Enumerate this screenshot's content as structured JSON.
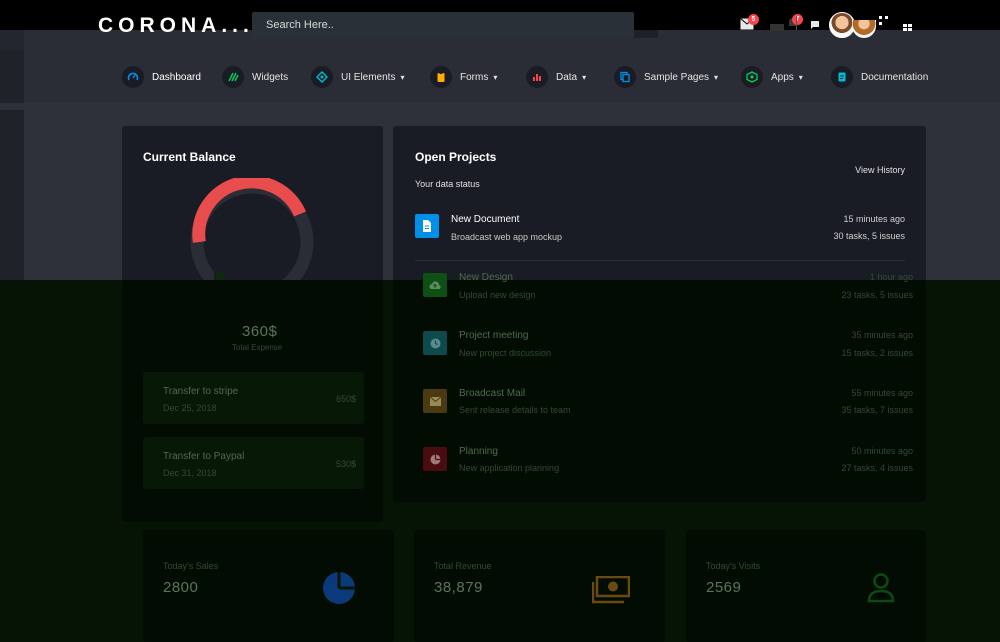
{
  "app": {
    "brand": "CORONA..."
  },
  "search": {
    "placeholder": "Search Here.."
  },
  "notifications": {
    "mail_count": "5",
    "alerts_count": "7"
  },
  "menu": [
    {
      "label": "Dashboard",
      "icon": "speedometer-icon",
      "color": "#0090e7",
      "has_dropdown": false
    },
    {
      "label": "Widgets",
      "icon": "widgets-icon",
      "color": "#00d25b",
      "has_dropdown": false
    },
    {
      "label": "UI Elements",
      "icon": "diamond-icon",
      "color": "#8f5fe8",
      "has_dropdown": true
    },
    {
      "label": "Forms",
      "icon": "clipboard-icon",
      "color": "#ffab00",
      "has_dropdown": true
    },
    {
      "label": "Data",
      "icon": "chart-icon",
      "color": "#fc424a",
      "has_dropdown": true
    },
    {
      "label": "Sample Pages",
      "icon": "copy-icon",
      "color": "#0090e7",
      "has_dropdown": true
    },
    {
      "label": "Apps",
      "icon": "cube-icon",
      "color": "#00d25b",
      "has_dropdown": true
    },
    {
      "label": "Documentation",
      "icon": "document-icon",
      "color": "#00bcd4",
      "has_dropdown": false
    }
  ],
  "balance": {
    "title": "Current Balance",
    "total": "360$",
    "total_label": "Total Expense",
    "transfers": [
      {
        "title": "Transfer to stripe",
        "date": "Dec 25, 2018",
        "amount": "650$"
      },
      {
        "title": "Transfer to Paypal",
        "date": "Dec 31, 2018",
        "amount": "530$"
      }
    ]
  },
  "projects": {
    "title": "Open Projects",
    "subtitle": "Your data status",
    "history_link": "View History",
    "items": [
      {
        "name": "New Document",
        "desc": "Broadcast web app mockup",
        "time": "15 minutes ago",
        "stats": "30 tasks, 5 issues",
        "color": "#0090e7",
        "icon": "file-icon"
      },
      {
        "name": "New Design",
        "desc": "Upload new design",
        "time": "1 hour ago",
        "stats": "23 tasks, 5 issues",
        "color": "#00d25b",
        "icon": "cloud-upload-icon"
      },
      {
        "name": "Project meeting",
        "desc": "New project discussion",
        "time": "35 minutes ago",
        "stats": "15 tasks, 2 issues",
        "color": "#00bcd4",
        "icon": "clock-icon"
      },
      {
        "name": "Broadcast Mail",
        "desc": "Sent release details to team",
        "time": "55 minutes ago",
        "stats": "35 tasks, 7 issues",
        "color": "#ffab00",
        "icon": "mail-icon"
      },
      {
        "name": "Planning",
        "desc": "New application planning",
        "time": "50 minutes ago",
        "stats": "27 tasks, 4 issues",
        "color": "#fc424a",
        "icon": "chart-pie-icon"
      }
    ]
  },
  "stats": [
    {
      "label": "Today's Sales",
      "value": "2800",
      "icon": "chart-pie-icon",
      "color": "#0090e7"
    },
    {
      "label": "Total Revenue",
      "value": "38,879",
      "icon": "cash-icon",
      "color": "#ffab00"
    },
    {
      "label": "Today's Visits",
      "value": "2569",
      "icon": "user-icon",
      "color": "#00d25b"
    }
  ]
}
